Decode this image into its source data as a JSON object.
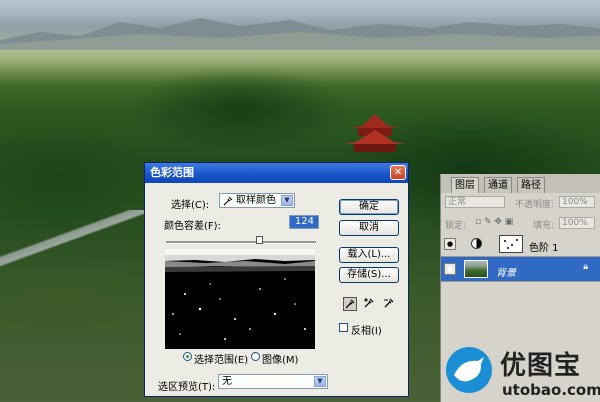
{
  "dialog": {
    "title": "色彩范围",
    "select_label": "选择(C):",
    "select_value": "取样颜色",
    "fuzziness_label": "颜色容差(F):",
    "fuzziness_value": "124",
    "radio_selection_label": "选择范围(E)",
    "radio_image_label": "图像(M)",
    "selection_preview_label": "选区预览(T):",
    "selection_preview_value": "无",
    "buttons": {
      "ok": "确定",
      "cancel": "取消",
      "load": "载入(L)...",
      "save": "存储(S)..."
    },
    "invert_label": "反相(I)",
    "close_glyph": "✕",
    "dropdown_glyph": "▼"
  },
  "layers_panel": {
    "tabs": [
      "图层",
      "通道",
      "路径"
    ],
    "blend_mode": "正常",
    "opacity_label": "不透明度:",
    "opacity_value": "100%",
    "lock_label": "锁定:",
    "fill_label": "填充:",
    "fill_value": "100%",
    "layers": [
      {
        "name": "色阶 1",
        "selected": false
      },
      {
        "name": "背景",
        "selected": true
      }
    ]
  },
  "watermark": {
    "name": "优图宝",
    "url": "utobao.com"
  },
  "colors": {
    "title_bar": "#1655c8",
    "selected_layer": "#316ac5",
    "logo_blue": "#1a8fd6"
  },
  "icons": [
    "close-icon",
    "eyedropper-icon",
    "eyedropper-plus-icon",
    "eyedropper-minus-icon",
    "eye-icon",
    "lock-icon",
    "bird-logo-icon"
  ]
}
